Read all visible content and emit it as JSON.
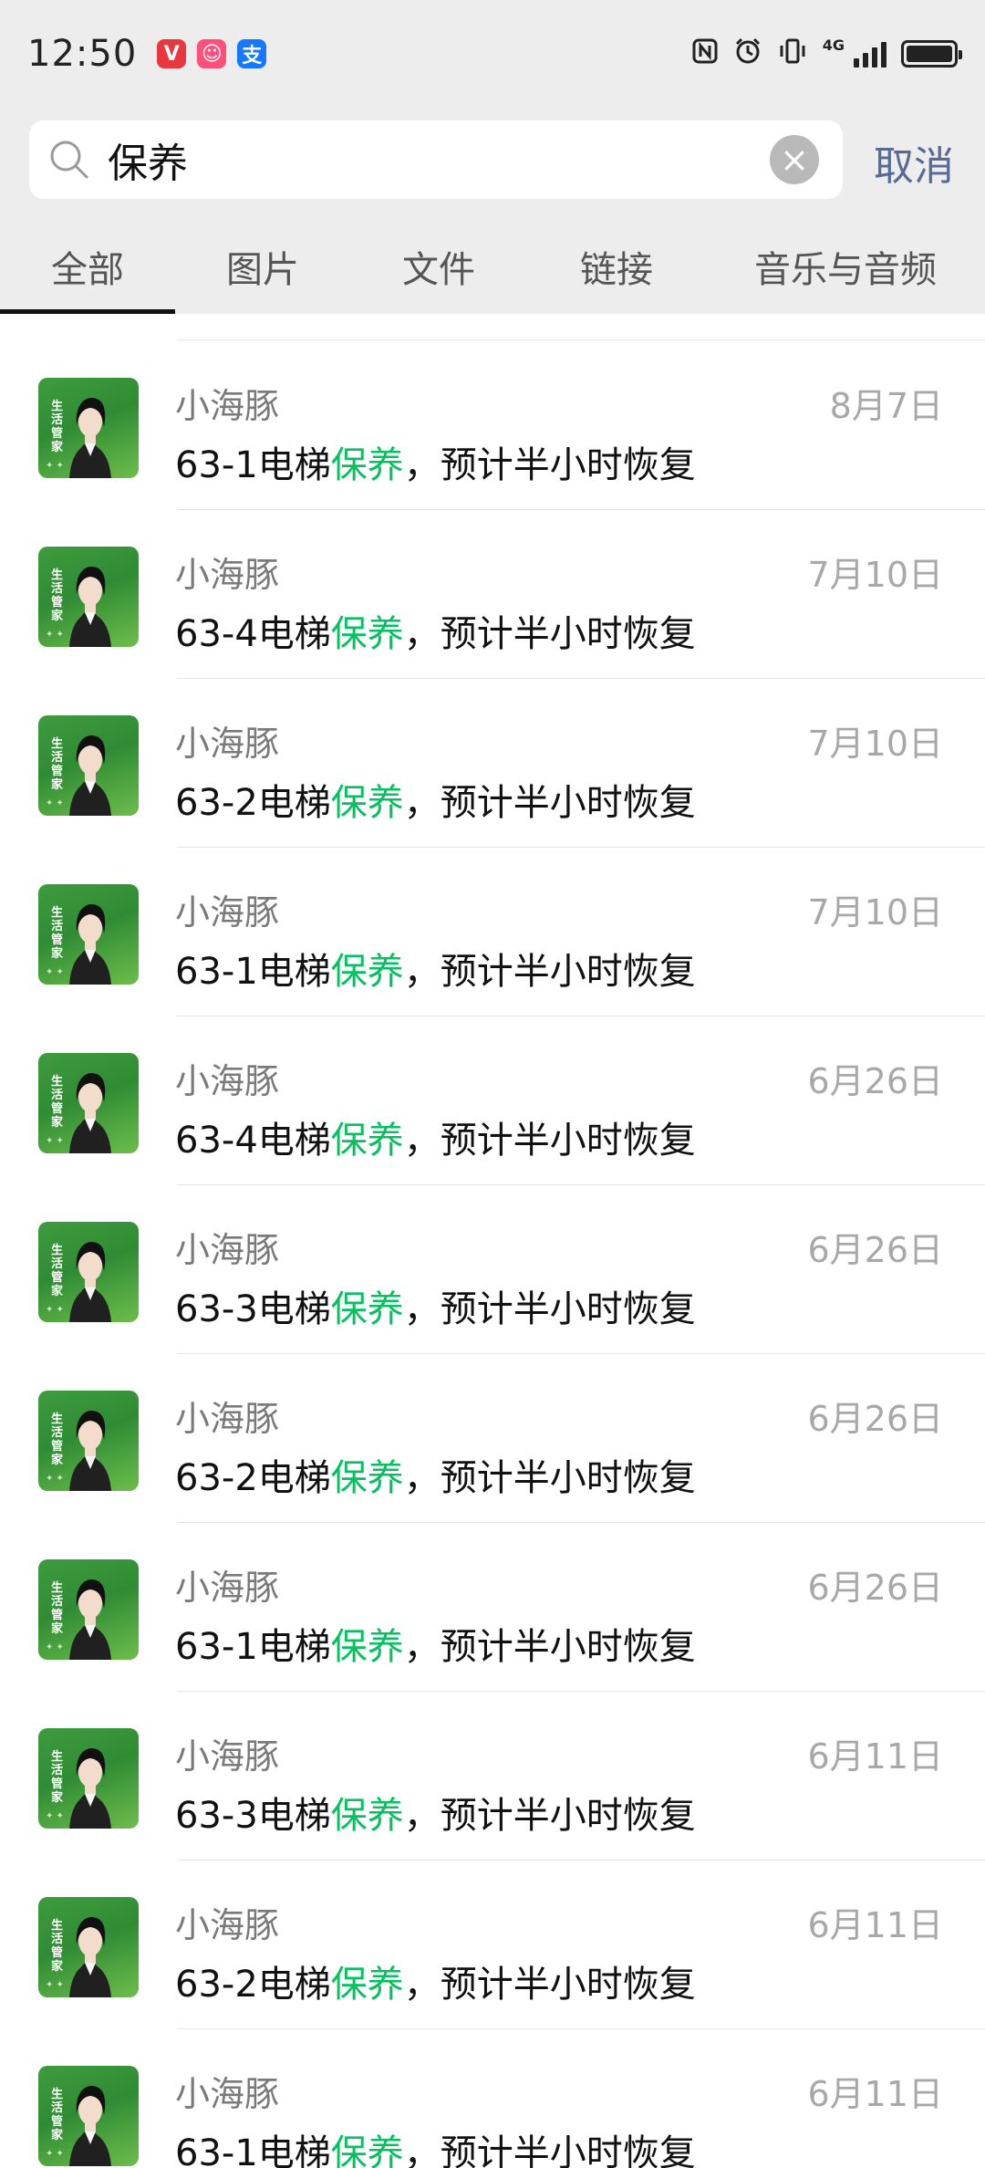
{
  "status_bar": {
    "time": "12:50",
    "apps": [
      {
        "icon": "vip-app-icon",
        "glyph": "V"
      },
      {
        "icon": "cartoon-app-icon",
        "glyph": "☺"
      },
      {
        "icon": "alipay-icon",
        "glyph": "支"
      }
    ],
    "network": "4G",
    "icons": [
      "nfc-icon",
      "alarm-icon",
      "vibrate-icon",
      "signal-icon",
      "battery-icon"
    ]
  },
  "search": {
    "query": "保养",
    "placeholder": "",
    "cancel_label": "取消"
  },
  "tabs": [
    {
      "label": "全部",
      "active": true
    },
    {
      "label": "图片",
      "active": false
    },
    {
      "label": "文件",
      "active": false
    },
    {
      "label": "链接",
      "active": false
    },
    {
      "label": "音乐与音频",
      "active": false
    }
  ],
  "colors": {
    "highlight": "#07c160",
    "cancel": "#576b95",
    "header_bg": "#ededed"
  },
  "avatar": {
    "label": "生活管家"
  },
  "results": [
    {
      "sender": "小海豚",
      "date": "8月7日",
      "prefix": "63-1电梯",
      "keyword": "保养",
      "suffix": "，预计半小时恢复"
    },
    {
      "sender": "小海豚",
      "date": "7月10日",
      "prefix": "63-4电梯",
      "keyword": "保养",
      "suffix": "，预计半小时恢复"
    },
    {
      "sender": "小海豚",
      "date": "7月10日",
      "prefix": "63-2电梯",
      "keyword": "保养",
      "suffix": "，预计半小时恢复"
    },
    {
      "sender": "小海豚",
      "date": "7月10日",
      "prefix": "63-1电梯",
      "keyword": "保养",
      "suffix": "，预计半小时恢复"
    },
    {
      "sender": "小海豚",
      "date": "6月26日",
      "prefix": "63-4电梯",
      "keyword": "保养",
      "suffix": "，预计半小时恢复"
    },
    {
      "sender": "小海豚",
      "date": "6月26日",
      "prefix": "63-3电梯",
      "keyword": "保养",
      "suffix": "，预计半小时恢复"
    },
    {
      "sender": "小海豚",
      "date": "6月26日",
      "prefix": "63-2电梯",
      "keyword": "保养",
      "suffix": "，预计半小时恢复"
    },
    {
      "sender": "小海豚",
      "date": "6月26日",
      "prefix": "63-1电梯",
      "keyword": "保养",
      "suffix": "，预计半小时恢复"
    },
    {
      "sender": "小海豚",
      "date": "6月11日",
      "prefix": "63-3电梯",
      "keyword": "保养",
      "suffix": "，预计半小时恢复"
    },
    {
      "sender": "小海豚",
      "date": "6月11日",
      "prefix": "63-2电梯",
      "keyword": "保养",
      "suffix": "，预计半小时恢复"
    },
    {
      "sender": "小海豚",
      "date": "6月11日",
      "prefix": "63-1电梯",
      "keyword": "保养",
      "suffix": "，预计半小时恢复"
    }
  ]
}
